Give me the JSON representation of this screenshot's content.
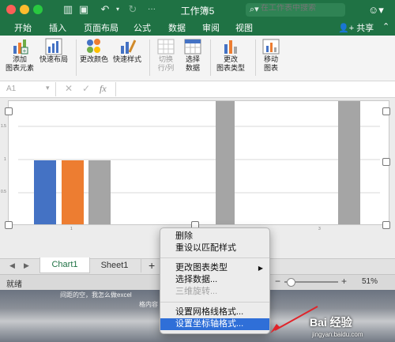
{
  "window": {
    "title": "工作簿5"
  },
  "search": {
    "placeholder": "在工作表中搜索"
  },
  "menu_tabs": [
    "开始",
    "插入",
    "页面布局",
    "公式",
    "数据",
    "审阅",
    "视图"
  ],
  "share_label": "共享",
  "ribbon": {
    "add_element": [
      "添加",
      "图表元素"
    ],
    "quick_layout": "快速布局",
    "change_color": "更改颜色",
    "quick_style": "快速样式",
    "switch_row_col": [
      "切换",
      "行/列"
    ],
    "select_data": [
      "选择",
      "数据"
    ],
    "change_type": [
      "更改",
      "图表类型"
    ],
    "move_chart": [
      "移动",
      "图表"
    ]
  },
  "formula_bar": {
    "name_box": "A1",
    "fx": "fx"
  },
  "chart_data": {
    "type": "bar",
    "ytick_labels": [
      "1.5",
      "1",
      "0.5"
    ],
    "xtick_labels": [
      "1",
      "3"
    ],
    "colors": [
      "#4472c4",
      "#ed7d31",
      "#a5a5a5"
    ]
  },
  "sheet_tabs": [
    "Chart1",
    "Sheet1"
  ],
  "add_sheet": "+",
  "status": {
    "ready": "就绪",
    "zoom": "51%",
    "minus": "−",
    "plus": "+"
  },
  "context_menu": {
    "items": [
      {
        "label": "删除",
        "disabled": false
      },
      {
        "label": "重设以匹配样式",
        "disabled": false
      },
      {
        "label": "更改图表类型",
        "disabled": false,
        "submenu": true
      },
      {
        "label": "选择数据...",
        "disabled": false
      },
      {
        "label": "三维旋转...",
        "disabled": true
      },
      {
        "label": "设置网格线格式...",
        "disabled": false
      },
      {
        "label": "设置坐标轴格式...",
        "disabled": false,
        "selected": true
      }
    ]
  },
  "desktop_text": [
    "间距的空，我怎么做excel",
    "格内容"
  ],
  "watermark": {
    "logo": "Bai 经验",
    "url": "jingyan.baidu.com"
  }
}
